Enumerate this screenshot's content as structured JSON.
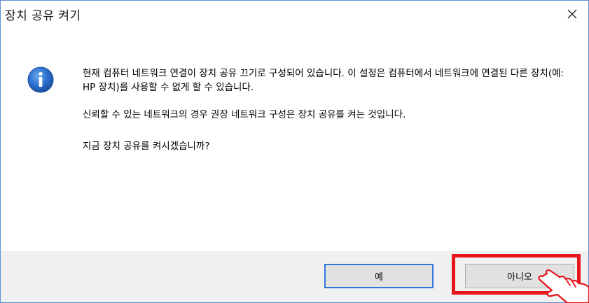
{
  "window": {
    "title": "장치 공유 켜기",
    "close_icon": "close-icon"
  },
  "message": {
    "icon": "info-icon",
    "line1": "현재 컴퓨터 네트워크 연결이 장치 공유 끄기로 구성되어 있습니다. 이 설정은 컴퓨터에서 네트워크에 연결된 다른 장치(예: HP 장치)를 사용할 수 없게 할 수 있습니다.",
    "line2": "신뢰할 수 있는 네트워크의 경우 권장 네트워크 구성은 장치 공유를 켜는 것입니다.",
    "line3": "지금 장치 공유를 켜시겠습니까?"
  },
  "buttons": {
    "yes_label": "예",
    "no_label": "아니오"
  },
  "annotation": {
    "highlight_color": "#e5161c",
    "pointer_icon": "hand-pointer-icon"
  },
  "colors": {
    "title_border": "#5b8fd8",
    "default_button_border": "#2f79d6",
    "dialog_background": "#f0f0f0"
  }
}
